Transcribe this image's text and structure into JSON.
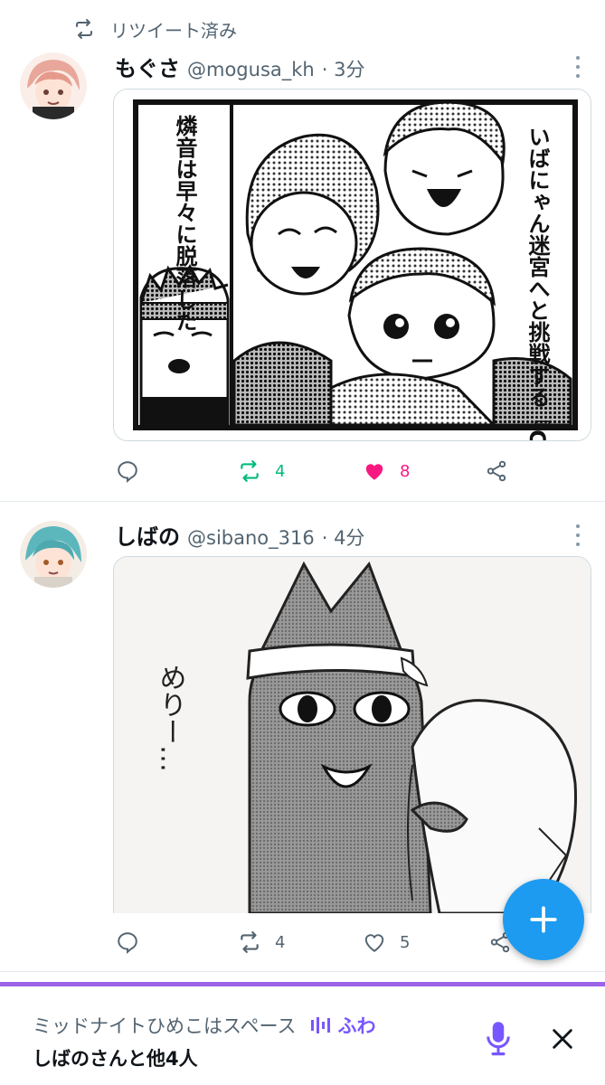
{
  "retweet_banner": {
    "label": "リツイート済み"
  },
  "tweets": [
    {
      "display_name": "もぐさ",
      "handle": "@mogusa_kh",
      "time": "· 3分",
      "manga_text_right": "いばにゃん迷宮へと挑戦する『Crazy:B』！",
      "manga_text_left": "燐音は早々に脱落した",
      "retweet_count": "4",
      "like_count": "8",
      "retweeted": true,
      "liked": true
    },
    {
      "display_name": "しばの",
      "handle": "@sibano_316",
      "time": "· 4分",
      "image_text": "めりー…",
      "retweet_count": "4",
      "like_count": "5",
      "retweeted": false,
      "liked": false
    }
  ],
  "spaces_bar": {
    "title": "ミッドナイトひめこはスペース",
    "live_label": "ふわ",
    "participants": "しばのさんと他4人"
  },
  "colors": {
    "accent_blue": "#1d9bf0",
    "retweet_green": "#00ba7c",
    "like_pink": "#f91880",
    "spaces_purple": "#7856ff",
    "secondary_text": "#536471"
  }
}
